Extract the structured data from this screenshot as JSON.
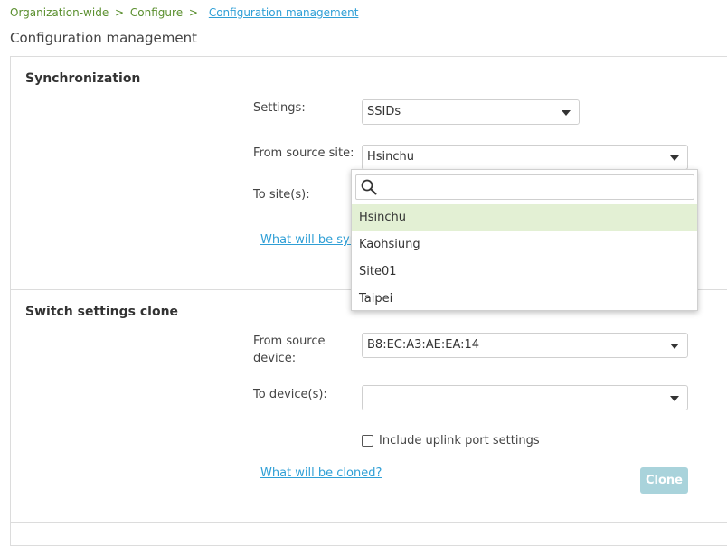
{
  "breadcrumb": {
    "items": [
      "Organization-wide",
      "Configure"
    ],
    "separator": ">",
    "current": "Configuration management"
  },
  "page_title": "Configuration management",
  "sync": {
    "title": "Synchronization",
    "settings_label": "Settings:",
    "settings_value": "SSIDs",
    "source_label": "From source site:",
    "source_value": "Hsinchu",
    "to_label": "To site(s):",
    "link_text": "What will be syn"
  },
  "dropdown": {
    "search_placeholder": "",
    "options": [
      "Hsinchu",
      "Kaohsiung",
      "Site01",
      "Taipei"
    ],
    "selected": "Hsinchu"
  },
  "clone": {
    "title": "Switch settings clone",
    "source_label_line1": "From source",
    "source_label_line2": "device:",
    "source_value": "B8:EC:A3:AE:EA:14",
    "to_label": "To device(s):",
    "to_value": "",
    "checkbox_label": "Include uplink port settings",
    "link_text": "What will be cloned?",
    "button_label": "Clone"
  },
  "colors": {
    "breadcrumb": "#5a8f2e",
    "link": "#2f9fd6",
    "selected_option_bg": "#e3f0d4",
    "clone_button_bg": "#a9d3db"
  }
}
